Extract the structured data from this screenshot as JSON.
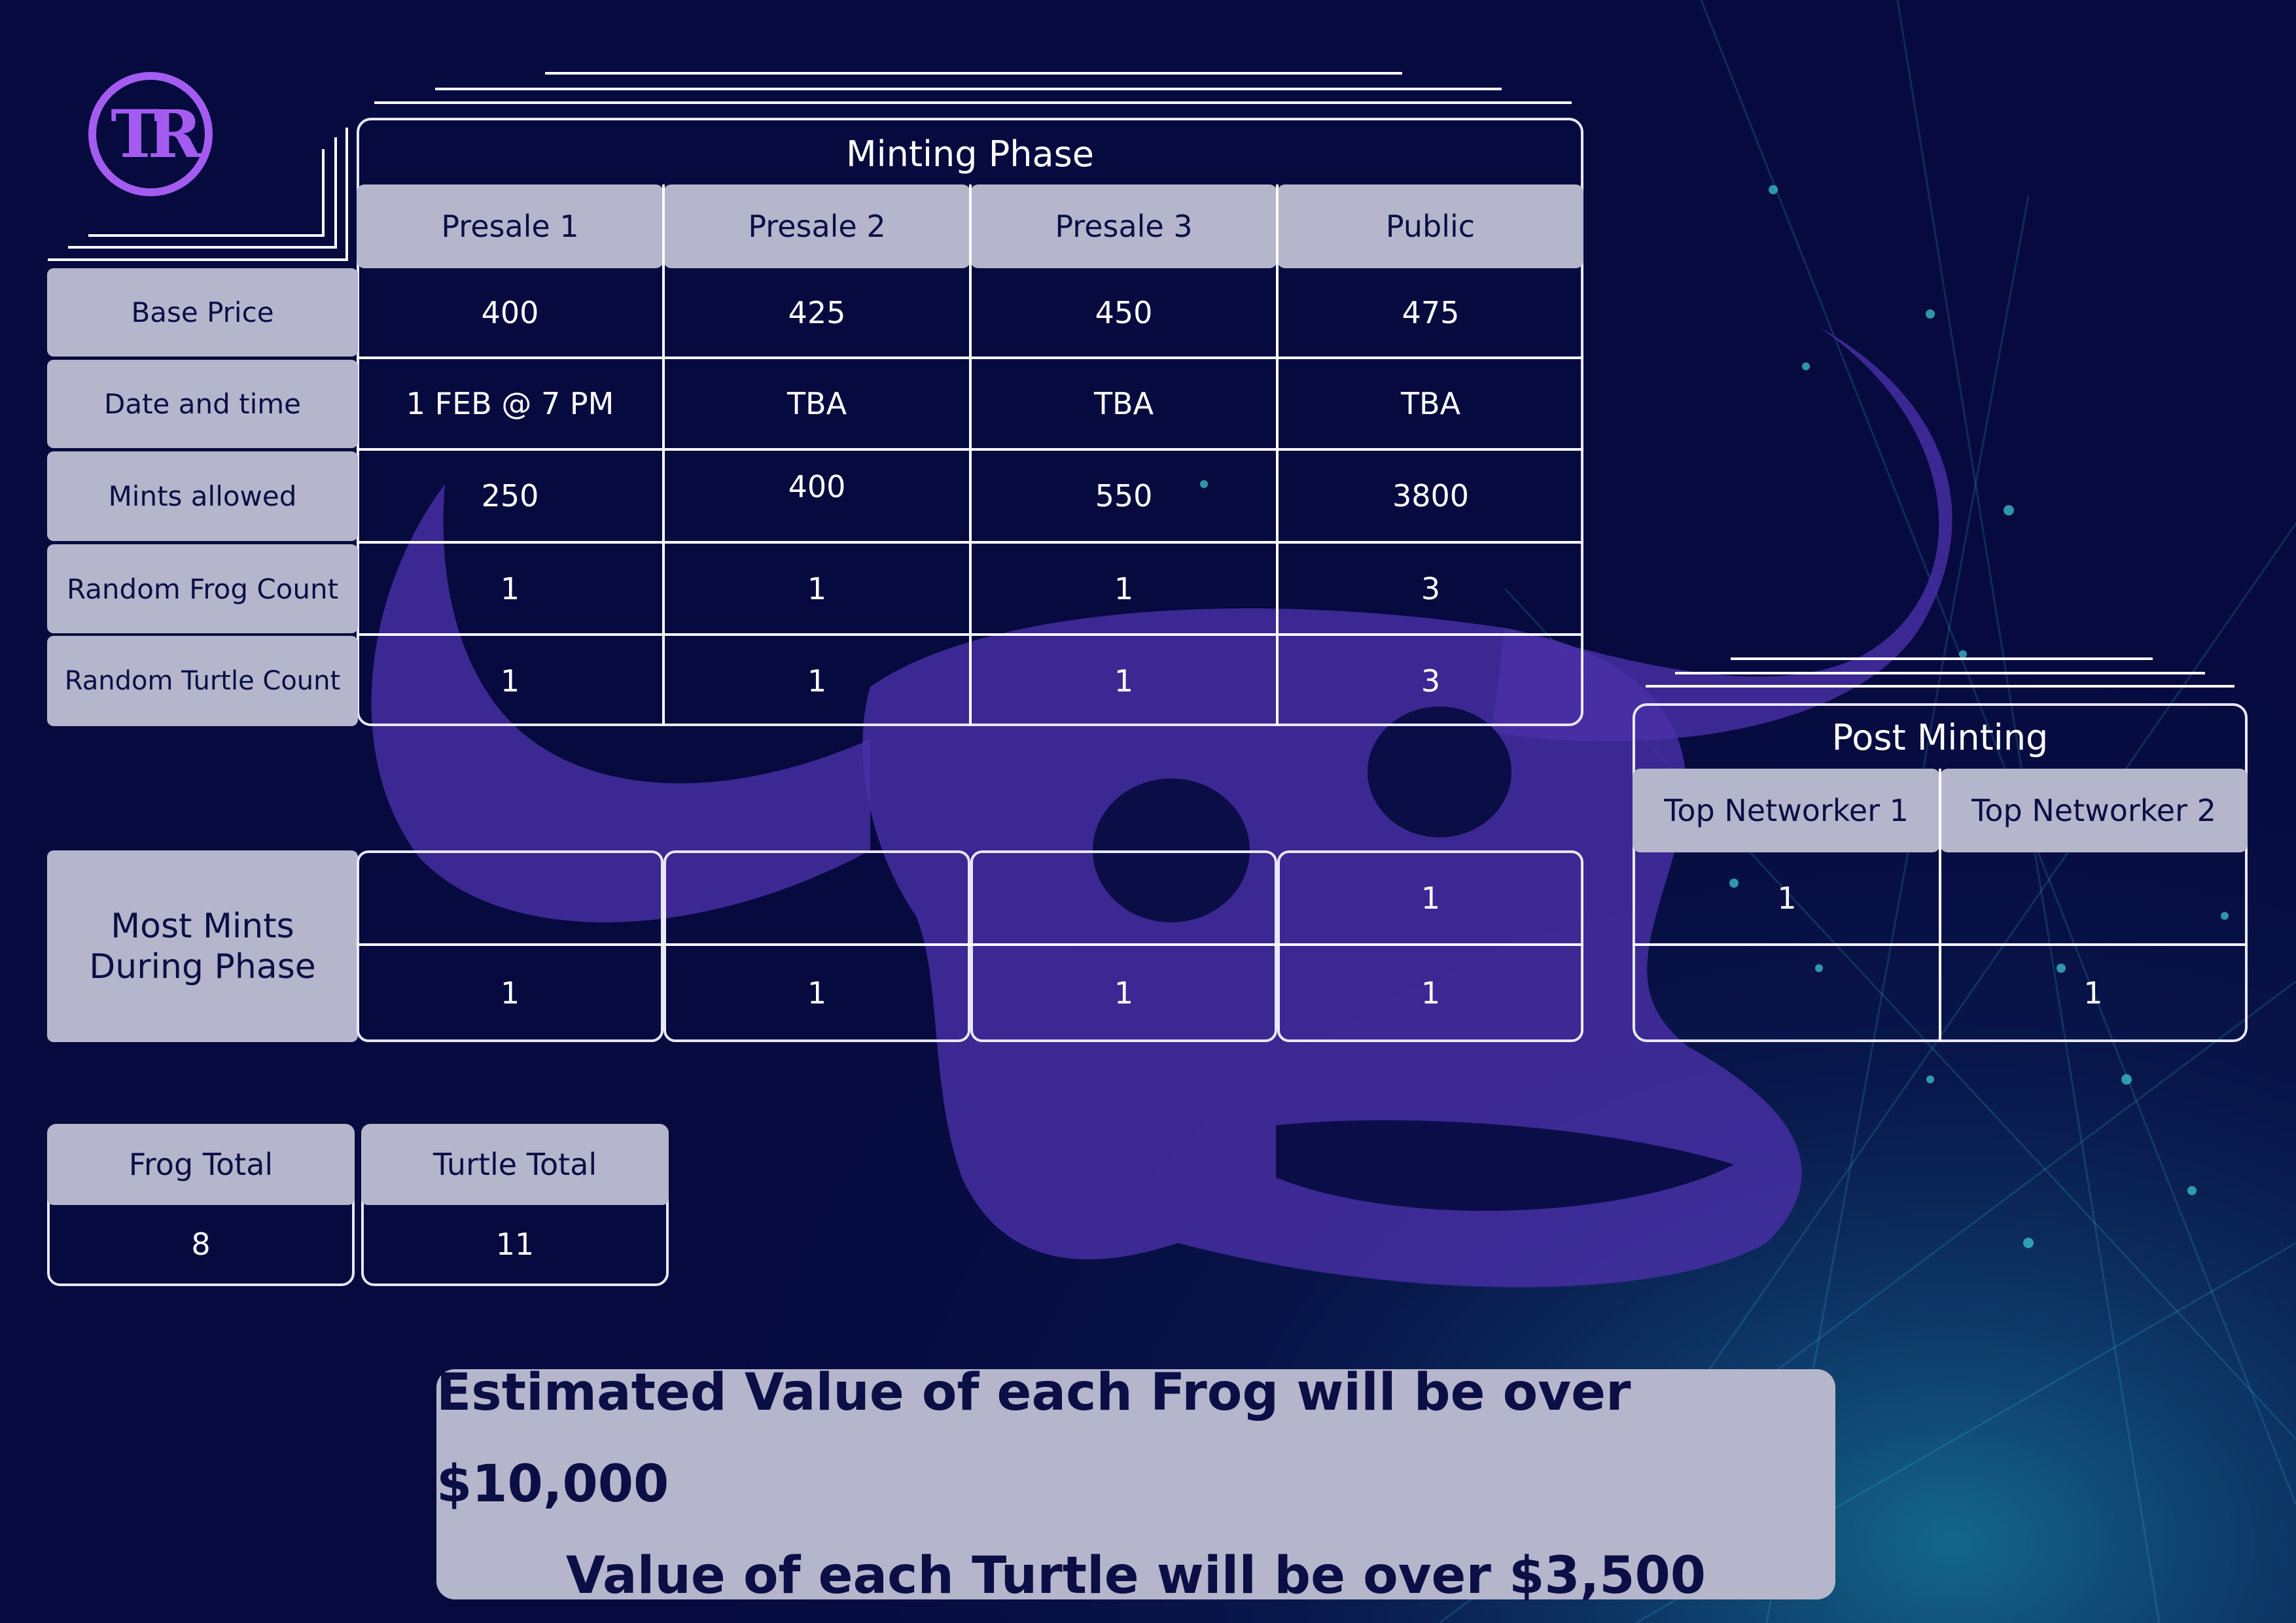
{
  "logo": {
    "text": "TR"
  },
  "minting": {
    "title": "Minting Phase",
    "columns": [
      "Presale 1",
      "Presale 2",
      "Presale 3",
      "Public"
    ],
    "rows": [
      {
        "label": "Base Price",
        "values": [
          "400",
          "425",
          "450",
          "475"
        ]
      },
      {
        "label": "Date and time",
        "values": [
          "1 FEB @ 7 PM",
          "TBA",
          "TBA",
          "TBA"
        ]
      },
      {
        "label": "Mints allowed",
        "values": [
          "250",
          "400",
          "550",
          "3800"
        ]
      },
      {
        "label": "Random Frog Count",
        "values": [
          "1",
          "1",
          "1",
          "3"
        ]
      },
      {
        "label": "Random Turtle Count",
        "values": [
          "1",
          "1",
          "1",
          "3"
        ]
      }
    ]
  },
  "most_mints": {
    "label": "Most Mints During Phase",
    "row1": [
      "",
      "",
      "",
      "1"
    ],
    "row2": [
      "1",
      "1",
      "1",
      "1"
    ]
  },
  "post_minting": {
    "title": "Post Minting",
    "columns": [
      "Top Networker 1",
      "Top Networker 2"
    ],
    "row1": [
      "1",
      ""
    ],
    "row2": [
      "",
      "1"
    ]
  },
  "totals": {
    "frog_label": "Frog Total",
    "frog_value": "8",
    "turtle_label": "Turtle Total",
    "turtle_value": "11"
  },
  "banner": {
    "line1": "Estimated Value of each Frog will be over $10,000",
    "line2": "Value of each Turtle will be over $3,500"
  },
  "colors": {
    "background": "#060a3f",
    "header_fill": "#b5b6cc",
    "accent_purple": "#6a3fd0",
    "text_dark": "#0b0f45"
  }
}
